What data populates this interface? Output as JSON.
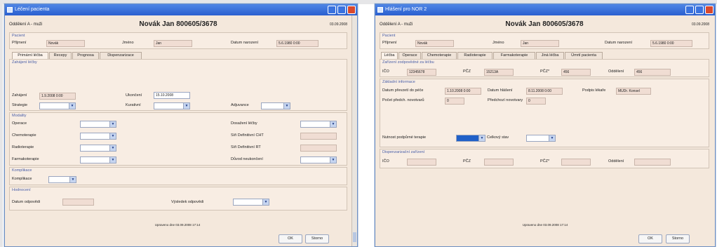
{
  "left_window": {
    "title": "Léčení pacienta",
    "department": "Oddělení A - muži",
    "patient_name": "Novák Jan 800605/3678",
    "date": "03.09.2008",
    "patient_section": "Pacient",
    "surname_label": "Příjmení",
    "surname_value": "Novák",
    "firstname_label": "Jméno",
    "firstname_value": "Jan",
    "birthdate_label": "Datum narození",
    "birthdate_value": "5.6.1980 0:00",
    "tabs": [
      "Primární léčba",
      "Recepy",
      "Prognosa",
      "Dispenzarizace"
    ],
    "start_section": "Zahájení léčby",
    "start_label": "Zahájení",
    "start_value": "1.9.2008 0:00",
    "end_label": "Ukončení",
    "end_value": "15.10.2008",
    "strategy_label": "Strategie",
    "curative_label": "Kurativní",
    "adjuvant_label": "Adjuvance",
    "modality_section": "Modality",
    "modalities": [
      "Operace",
      "Chemoterapie",
      "Radioterapie",
      "Farmakoterapie"
    ],
    "right_modalities": [
      "Dosažení léčby",
      "Síň Definitivní CHT",
      "Síň Definitivní RT",
      "Důvod neukončení"
    ],
    "complication_section": "Komplikace",
    "complication_label": "Komplikace",
    "eval_section": "Hodnocení",
    "eval_date_label": "Datum odpovědi",
    "eval_result_label": "Výsledek odpovědi",
    "footer_text": "Upraveno dne 03.09.2008 17:14",
    "ok_label": "OK",
    "cancel_label": "Storno"
  },
  "right_window": {
    "title": "Hlášení pro NOR 2",
    "department": "Oddělení A - muži",
    "patient_name": "Novák Jan 800605/3678",
    "date": "03.09.2008",
    "patient_section": "Pacient",
    "surname_label": "Příjmení",
    "surname_value": "Novák",
    "firstname_label": "Jméno",
    "firstname_value": "Jan",
    "birthdate_label": "Datum narození",
    "birthdate_value": "5.6.1980 0:00",
    "tabs": [
      "Léčba",
      "Operace",
      "Chemoterapie",
      "Radioterapie",
      "Farmakoterapie",
      "Jiná léčba",
      "Úmrtí pacienta"
    ],
    "facility_section": "Zařízení zodpovědné za léčbu",
    "ico_label": "IČO",
    "ico_value": "12345678",
    "pcz_label": "PČZ",
    "pcz_value": "15213A",
    "pcz2_label": "PČZ*",
    "pcz2_value": "456",
    "odd_label": "Oddělení",
    "odd_value": "456",
    "base_section": "Základní informace",
    "transfer_label": "Datum převzetí do péče",
    "transfer_value": "1.10.2008 0:00",
    "report_label": "Datum hlášení",
    "report_value": "8.11.2008 0:00",
    "reporter_label": "Podpis lékaře",
    "reporter_value": "MUDr. Konsel",
    "count_label": "Počet předch. novotvarů",
    "count_value": "0",
    "prev_label": "Předchozí novotvary",
    "prev_value": "0",
    "need_label": "Nutnost podpůrné terapie",
    "state_label": "Celkový stav",
    "disp_section": "Dispenzarizační zařízení",
    "footer_text": "Upraveno dne 03.09.2008 17:14",
    "ok_label": "OK",
    "cancel_label": "Storno"
  }
}
